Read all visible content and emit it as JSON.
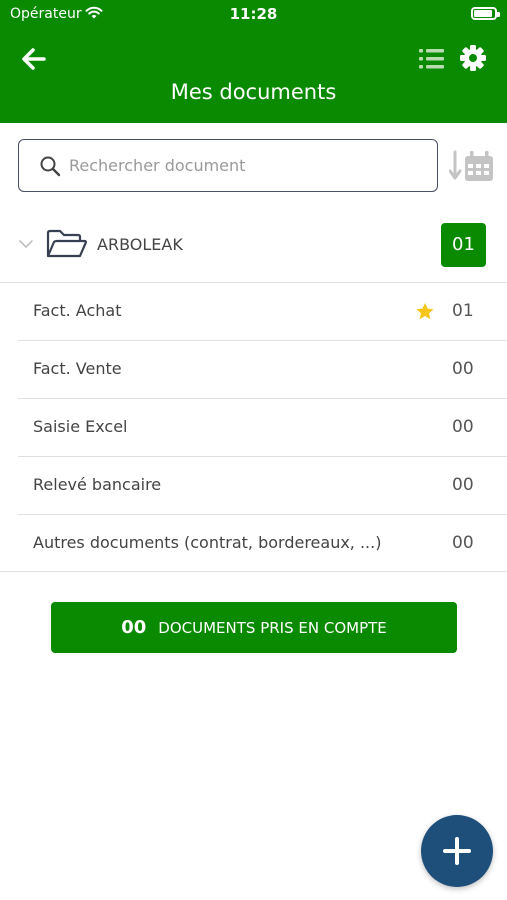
{
  "status_bar": {
    "carrier": "Opérateur",
    "time": "11:28"
  },
  "header": {
    "title": "Mes documents"
  },
  "search": {
    "placeholder": "Rechercher document",
    "value": ""
  },
  "folder": {
    "name": "ARBOLEAK",
    "count": "01"
  },
  "documents": [
    {
      "label": "Fact. Achat",
      "count": "01",
      "starred": true
    },
    {
      "label": "Fact. Vente",
      "count": "00",
      "starred": false
    },
    {
      "label": "Saisie Excel",
      "count": "00",
      "starred": false
    },
    {
      "label": "Relevé bancaire",
      "count": "00",
      "starred": false
    },
    {
      "label": "Autres documents (contrat, bordereaux, ...)",
      "count": "00",
      "starred": false
    }
  ],
  "summary_button": {
    "count": "00",
    "label": "DOCUMENTS PRIS EN COMPTE"
  },
  "colors": {
    "brand_green": "#0a8a00",
    "fab_blue": "#1e4e7a",
    "star": "#f5c518"
  },
  "icons": [
    "wifi-icon",
    "battery-icon",
    "back-arrow-icon",
    "list-icon",
    "gear-icon",
    "search-icon",
    "sort-date-icon",
    "chevron-down-icon",
    "folder-open-icon",
    "star-icon",
    "plus-icon"
  ]
}
